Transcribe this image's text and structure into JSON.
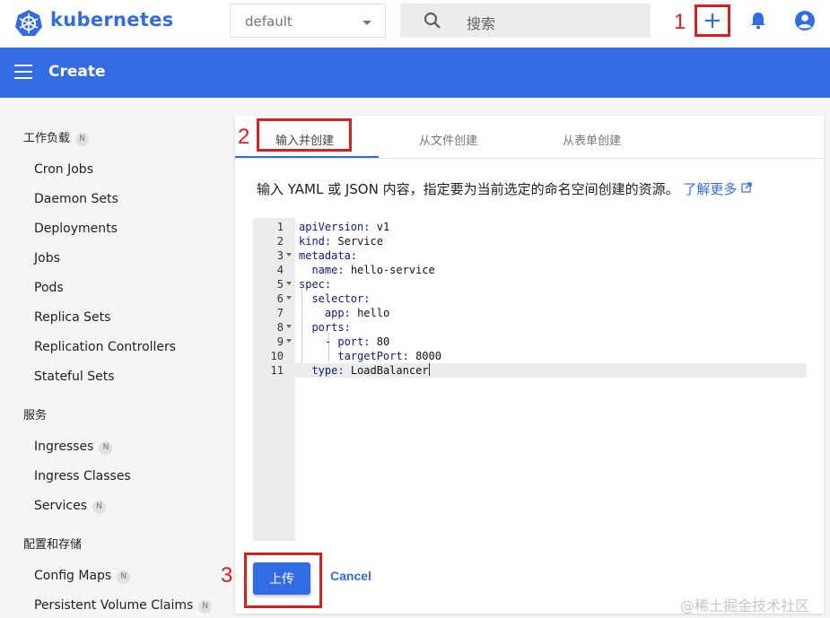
{
  "app": {
    "brand": "kubernetes"
  },
  "header": {
    "namespace_value": "default",
    "search_placeholder": "搜索",
    "annotation_1": "1"
  },
  "page": {
    "title": "Create"
  },
  "sidebar": {
    "sections": [
      {
        "label": "工作负载",
        "badge": "N",
        "items": [
          {
            "label": "Cron Jobs"
          },
          {
            "label": "Daemon Sets"
          },
          {
            "label": "Deployments"
          },
          {
            "label": "Jobs"
          },
          {
            "label": "Pods"
          },
          {
            "label": "Replica Sets"
          },
          {
            "label": "Replication Controllers"
          },
          {
            "label": "Stateful Sets"
          }
        ]
      },
      {
        "label": "服务",
        "items": [
          {
            "label": "Ingresses",
            "badge": "N"
          },
          {
            "label": "Ingress Classes"
          },
          {
            "label": "Services",
            "badge": "N"
          }
        ]
      },
      {
        "label": "配置和存储",
        "items": [
          {
            "label": "Config Maps",
            "badge": "N"
          },
          {
            "label": "Persistent Volume Claims",
            "badge": "N"
          }
        ]
      }
    ]
  },
  "tabs": [
    {
      "label": "输入并创建",
      "active": true
    },
    {
      "label": "从文件创建"
    },
    {
      "label": "从表单创建"
    }
  ],
  "annotation_2": "2",
  "annotation_3": "3",
  "description": "输入 YAML 或 JSON 内容，指定要为当前选定的命名空间创建的资源。",
  "learn_more": "了解更多",
  "editor": {
    "lines": [
      {
        "n": "1",
        "key": "apiVersion",
        "val": "v1",
        "indent": ""
      },
      {
        "n": "2",
        "key": "kind",
        "val": "Service",
        "indent": ""
      },
      {
        "n": "3",
        "key": "metadata",
        "val": "",
        "indent": ""
      },
      {
        "n": "4",
        "key": "name",
        "val": "hello-service",
        "indent": "  "
      },
      {
        "n": "5",
        "key": "spec",
        "val": "",
        "indent": ""
      },
      {
        "n": "6",
        "key": "selector",
        "val": "",
        "indent": "  "
      },
      {
        "n": "7",
        "key": "app",
        "val": "hello",
        "indent": "    "
      },
      {
        "n": "8",
        "key": "ports",
        "val": "",
        "indent": "  "
      },
      {
        "n": "9",
        "key": "port",
        "val": "80",
        "indent": "    - "
      },
      {
        "n": "10",
        "key": "targetPort",
        "val": "8000",
        "indent": "      "
      },
      {
        "n": "11",
        "key": "type",
        "val": "LoadBalancer",
        "indent": "  "
      }
    ]
  },
  "buttons": {
    "upload": "上传",
    "cancel": "Cancel"
  },
  "watermark": "@稀土掘金技术社区",
  "colors": {
    "primary": "#326ce5",
    "annotation": "#d81e1e"
  }
}
